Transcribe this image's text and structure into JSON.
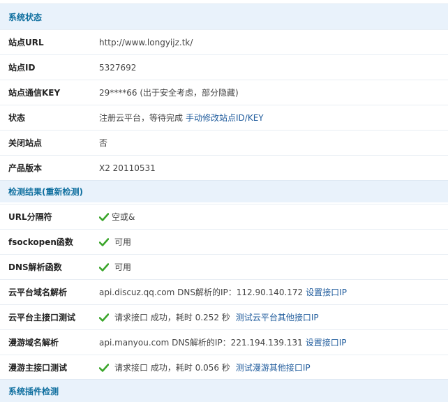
{
  "sections": {
    "system_status": "系统状态",
    "detection_results": "检测结果(重新检测)",
    "plugin_check": "系统插件检测"
  },
  "site_rows": [
    {
      "label": "站点URL",
      "value": "http://www.longyijz.tk/"
    },
    {
      "label": "站点ID",
      "value": "5327692"
    },
    {
      "label": "站点通信KEY",
      "value": "29****66 (出于安全考虑，部分隐藏)"
    },
    {
      "label": "状态",
      "value": "注册云平台，等待完成",
      "link": "手动修改站点ID/KEY"
    },
    {
      "label": "关闭站点",
      "value": "否"
    },
    {
      "label": "产品版本",
      "value": "X2 20110531"
    }
  ],
  "check_rows": [
    {
      "label": "URL分隔符",
      "value": "空或&",
      "check": true
    },
    {
      "label": "fsockopen函数",
      "value": "可用",
      "check": true
    },
    {
      "label": "DNS解析函数",
      "value": "可用",
      "check": true
    },
    {
      "label": "云平台域名解析",
      "value": "api.discuz.qq.com DNS解析的IP：112.90.140.172",
      "link": "设置接口IP"
    },
    {
      "label": "云平台主接口测试",
      "value": "请求接口 成功，耗时 0.252 秒",
      "link": "测试云平台其他接口IP",
      "check": true
    },
    {
      "label": "漫游域名解析",
      "value": "api.manyou.com DNS解析的IP：221.194.139.131",
      "link": "设置接口IP"
    },
    {
      "label": "漫游主接口测试",
      "value": "请求接口 成功，耗时 0.056 秒",
      "link": "测试漫游其他接口IP",
      "check": true
    }
  ],
  "colors": {
    "accent": "#0f6f9f",
    "section_bg": "#e9f2fb",
    "link": "#1f5b9c",
    "check": "#3aa52a"
  },
  "icons": {
    "check": "check-icon"
  }
}
